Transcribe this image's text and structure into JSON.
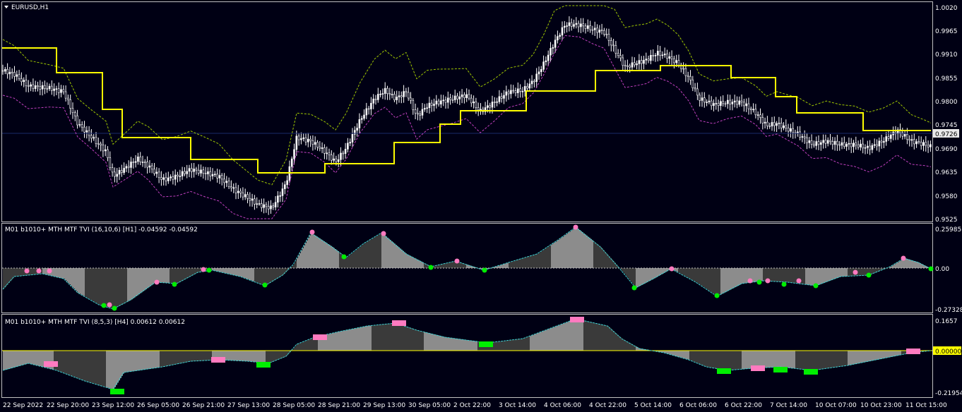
{
  "window": {
    "title": "EURUSD,H1",
    "menu_icon": "triangle-down-icon",
    "colors": {
      "background": "#000014",
      "grid_border": "#c0c0c0",
      "bull": "#ffffff",
      "bear": "#ffffff",
      "ma_line": "#ffff00",
      "upper_band": "#a0c800",
      "lower_band": "#c040c0",
      "tvi_fill_light": "#8c8c8c",
      "tvi_fill_dark": "#3a3a3a",
      "tvi_line": "#40d0d0",
      "marker_pink": "#ff7ac0",
      "marker_green": "#00ee00",
      "zero_line_h4": "#ffff00"
    }
  },
  "main_panel": {
    "price_labels": [
      "1.0020",
      "0.9965",
      "0.9910",
      "0.9855",
      "0.9800",
      "0.9745",
      "0.9690",
      "0.9635",
      "0.9580",
      "0.9525"
    ],
    "current_price": "0.9726"
  },
  "indicator1": {
    "title": "M01 b1010+ MTH MTF TVI (16,10,6) [H1] -0.04592 -0.04592",
    "labels": [
      "0.25985",
      "0.00",
      "-0.27328"
    ]
  },
  "indicator2": {
    "title": "M01 b1010+ MTH MTF TVI (8,5,3) [H4] 0.00612 0.00612",
    "labels": [
      "0.1657",
      "0.00000",
      "-0.21954"
    ]
  },
  "time_axis": [
    "22 Sep 2022",
    "22 Sep 20:00",
    "23 Sep 12:00",
    "26 Sep 05:00",
    "26 Sep 21:00",
    "27 Sep 13:00",
    "28 Sep 05:00",
    "28 Sep 21:00",
    "29 Sep 13:00",
    "30 Sep 05:00",
    "2 Oct 22:00",
    "3 Oct 14:00",
    "4 Oct 06:00",
    "4 Oct 22:00",
    "5 Oct 14:00",
    "6 Oct 06:00",
    "6 Oct 22:00",
    "7 Oct 14:00",
    "10 Oct 07:00",
    "10 Oct 23:00",
    "11 Oct 15:00"
  ]
}
